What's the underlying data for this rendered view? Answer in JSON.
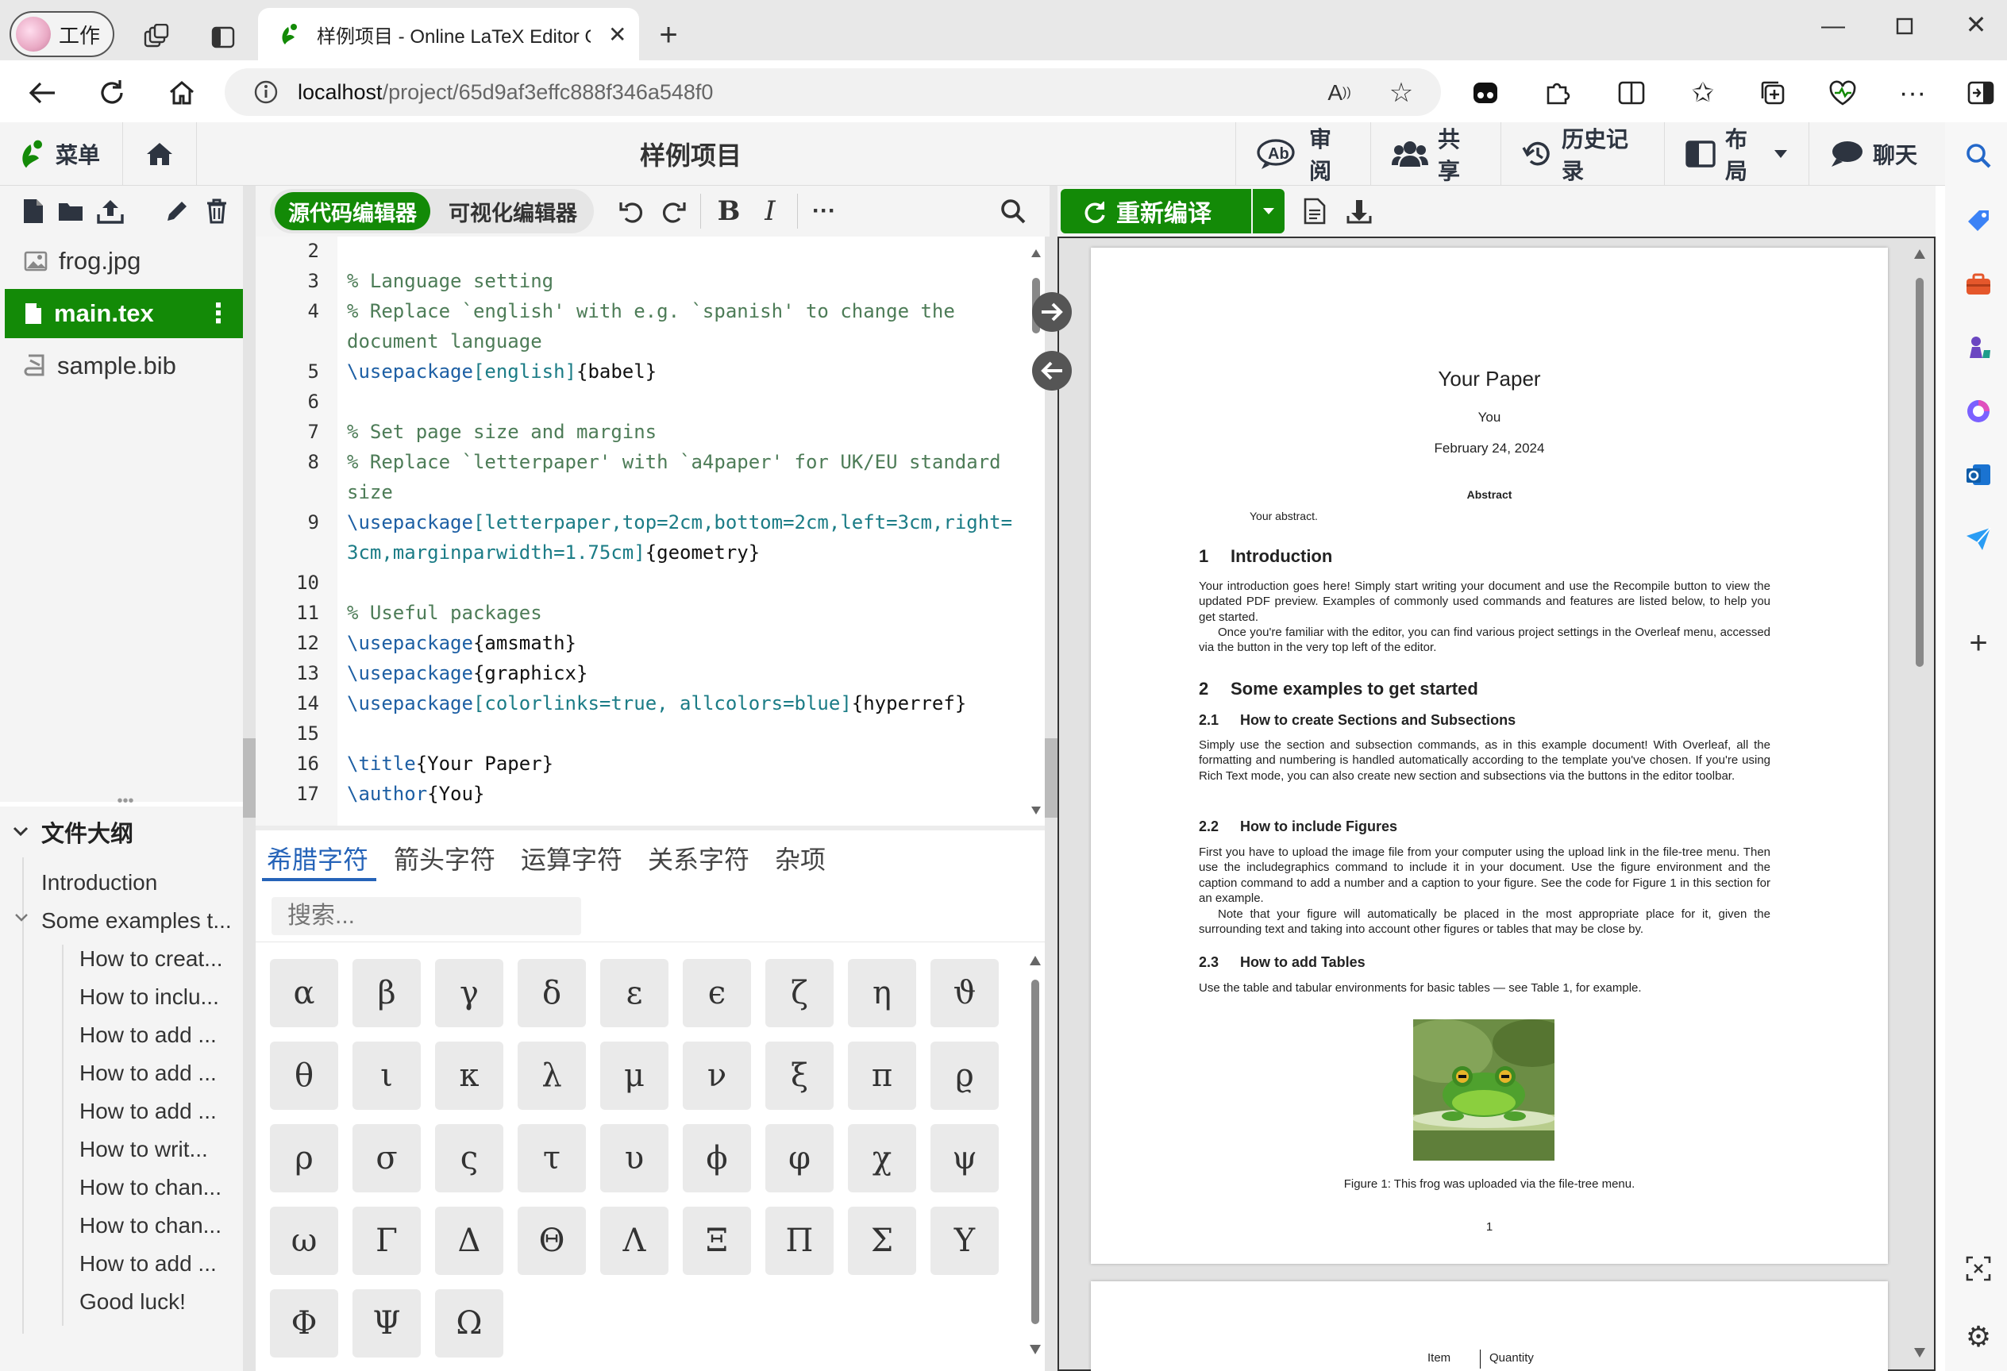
{
  "browser": {
    "profile_label": "工作",
    "tab_title": "样例项目 - Online LaTeX Editor Overleaf",
    "address_host": "localhost",
    "address_path": "/project/65d9af3effc888f346a548f0"
  },
  "topbar": {
    "menu_label": "菜单",
    "project_title": "样例项目",
    "review_label": "审阅",
    "share_label": "共享",
    "history_label": "历史记录",
    "layout_label": "布局",
    "chat_label": "聊天"
  },
  "filetree": {
    "files": [
      {
        "name": "frog.jpg",
        "icon": "image-file-icon"
      },
      {
        "name": "main.tex",
        "icon": "file-icon",
        "selected": true
      },
      {
        "name": "sample.bib",
        "icon": "bib-file-icon"
      }
    ]
  },
  "outline": {
    "title": "文件大纲",
    "items": [
      "Introduction",
      "Some examples t...",
      "How to creat...",
      "How to inclu...",
      "How to add ...",
      "How to add ...",
      "How to add ...",
      "How to writ...",
      "How to chan...",
      "How to chan...",
      "How to add ...",
      "Good luck!"
    ]
  },
  "editor": {
    "mode_source": "源代码编辑器",
    "mode_visual": "可视化编辑器",
    "line_numbers": [
      "2",
      "3",
      "4",
      "5",
      "6",
      "7",
      "8",
      "9",
      "10",
      "11",
      "12",
      "13",
      "14",
      "15",
      "16",
      "17"
    ],
    "code_lines": {
      "l3": "% Language setting",
      "l4a": "% Replace `english' with e.g. `spanish' to change the",
      "l4b": "document language",
      "l5_cmd": "\\usepackage",
      "l5_arg": "[english]",
      "l5_rest": "{babel}",
      "l7": "% Set page size and margins",
      "l8a": "% Replace `letterpaper' with `a4paper' for UK/EU standard",
      "l8b": "size",
      "l9_cmd": "\\usepackage",
      "l9_arg1": "[letterpaper,top=2cm,bottom=2cm,left=3cm,right=",
      "l9_arg2": "3cm,marginparwidth=1.75cm]",
      "l9_rest": "{geometry}",
      "l11": "% Useful packages",
      "l12_cmd": "\\usepackage",
      "l12_rest": "{amsmath}",
      "l13_cmd": "\\usepackage",
      "l13_rest": "{graphicx}",
      "l14_cmd": "\\usepackage",
      "l14_arg": "[colorlinks=true, allcolors=blue]",
      "l14_rest": "{hyperref}",
      "l16_cmd": "\\title",
      "l16_rest": "{Your Paper}",
      "l17_cmd": "\\author",
      "l17_rest": "{You}"
    }
  },
  "symbols": {
    "tabs": [
      "希腊字符",
      "箭头字符",
      "运算字符",
      "关系字符",
      "杂项"
    ],
    "search_placeholder": "搜索...",
    "greek": [
      "α",
      "β",
      "γ",
      "δ",
      "ε",
      "ϵ",
      "ζ",
      "η",
      "ϑ",
      "θ",
      "ι",
      "κ",
      "λ",
      "μ",
      "ν",
      "ξ",
      "π",
      "ϱ",
      "ρ",
      "σ",
      "ς",
      "τ",
      "υ",
      "ϕ",
      "φ",
      "χ",
      "ψ",
      "ω",
      "Γ",
      "Δ",
      "Θ",
      "Λ",
      "Ξ",
      "Π",
      "Σ",
      "Υ",
      "Φ",
      "Ψ",
      "Ω"
    ]
  },
  "pdf": {
    "recompile_label": "重新编译",
    "title": "Your Paper",
    "author": "You",
    "date": "February 24, 2024",
    "abstract_heading": "Abstract",
    "abstract_text": "Your abstract.",
    "s1_num": "1",
    "s1_title": "Introduction",
    "s1_p1": "Your introduction goes here! Simply start writing your document and use the Recompile button to view the updated PDF preview. Examples of commonly used commands and features are listed below, to help you get started.",
    "s1_p2": "Once you're familiar with the editor, you can find various project settings in the Overleaf menu, accessed via the button in the very top left of the editor.",
    "s2_num": "2",
    "s2_title": "Some examples to get started",
    "s21_num": "2.1",
    "s21_title": "How to create Sections and Subsections",
    "s21_p": "Simply use the section and subsection commands, as in this example document! With Overleaf, all the formatting and numbering is handled automatically according to the template you've chosen. If you're using Rich Text mode, you can also create new section and subsections via the buttons in the editor toolbar.",
    "s22_num": "2.2",
    "s22_title": "How to include Figures",
    "s22_p1": "First you have to upload the image file from your computer using the upload link in the file-tree menu. Then use the includegraphics command to include it in your document. Use the figure environment and the caption command to add a number and a caption to your figure. See the code for Figure 1 in this section for an example.",
    "s22_p2": "Note that your figure will automatically be placed in the most appropriate place for it, given the surrounding text and taking into account other figures or tables that may be close by.",
    "s23_num": "2.3",
    "s23_title": "How to add Tables",
    "s23_p": "Use the table and tabular environments for basic tables — see Table 1, for example.",
    "figure_caption": "Figure 1: This frog was uploaded via the file-tree menu.",
    "page_number": "1",
    "table_col1": "Item",
    "table_col2": "Quantity"
  },
  "colors": {
    "accent_green": "#138a07",
    "link_blue": "#1a3fd6"
  }
}
